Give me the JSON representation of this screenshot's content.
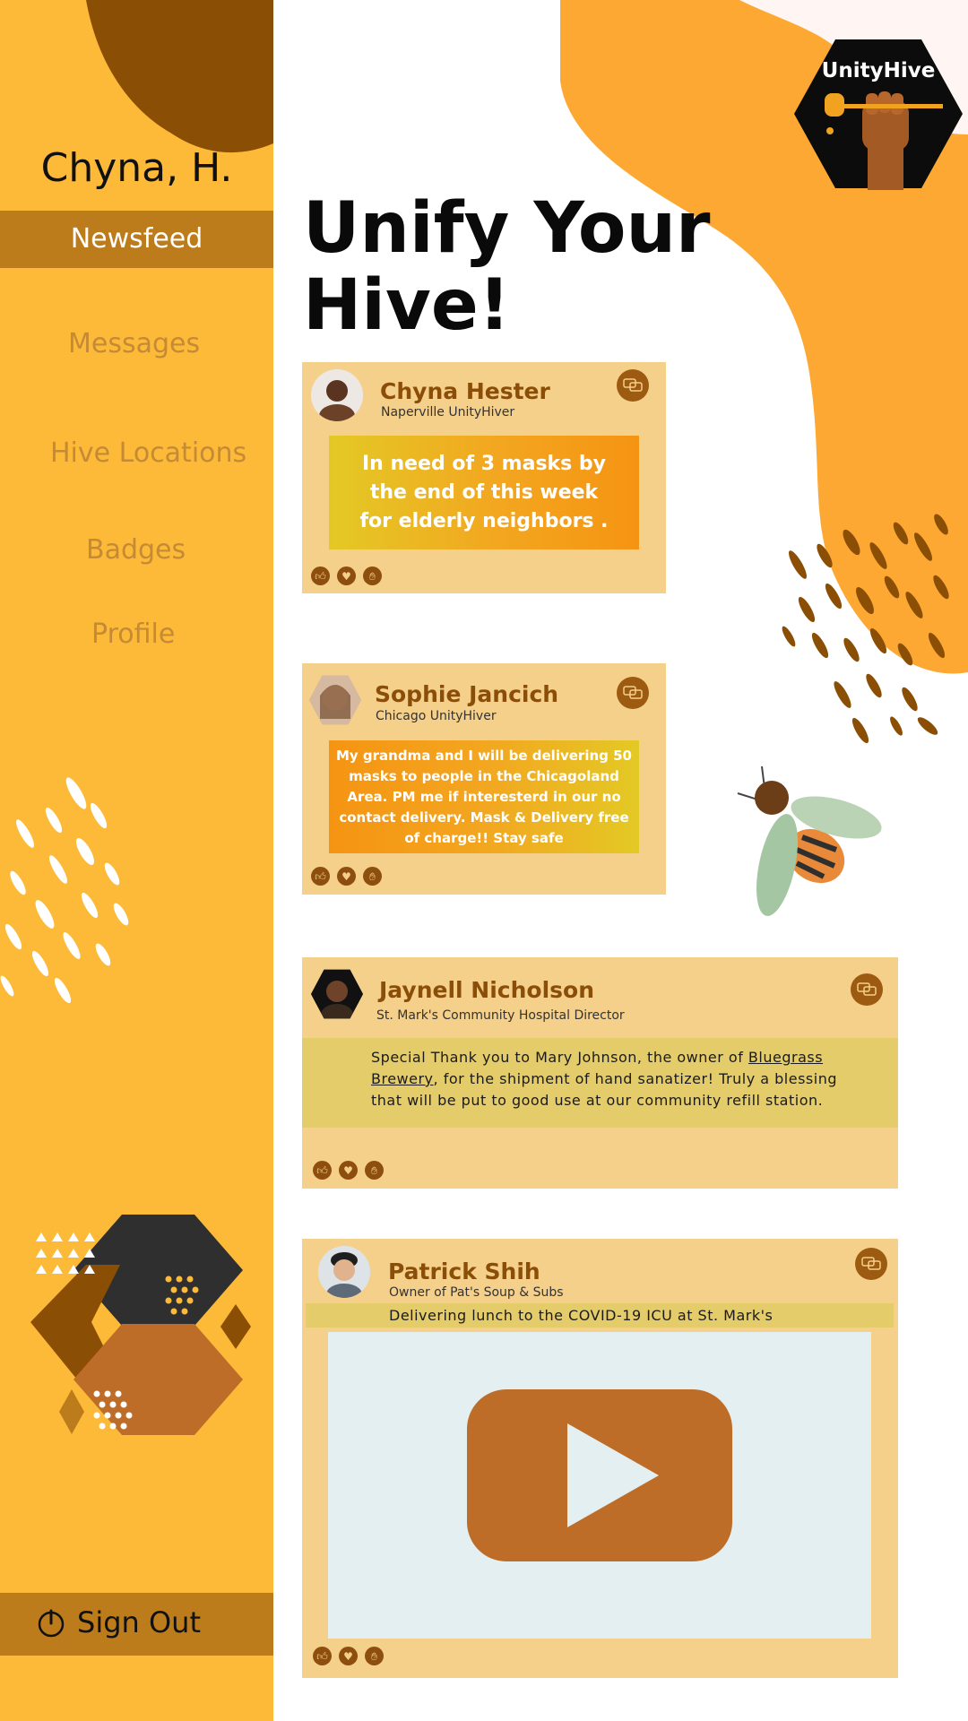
{
  "app": {
    "logo_text": "UnityHive",
    "headline": "Unify Your Hive!"
  },
  "sidebar": {
    "user_name": "Chyna, H.",
    "items": [
      {
        "label": "Newsfeed",
        "active": true
      },
      {
        "label": "Messages"
      },
      {
        "label": "Hive Locations"
      },
      {
        "label": "Badges"
      },
      {
        "label": "Profile"
      }
    ],
    "sign_out": "Sign Out"
  },
  "posts": [
    {
      "author": "Chyna Hester",
      "subtitle": "Naperville UnityHiver",
      "message": "In need of 3 masks by the end of this week for elderly neighbors ."
    },
    {
      "author": "Sophie Jancich",
      "subtitle": "Chicago UnityHiver",
      "message": "My grandma and I will be delivering 50 masks to people in the Chicagoland Area. PM me if interesterd in our no contact delivery. Mask & Delivery free  of charge!! Stay safe"
    },
    {
      "author": "Jaynell Nicholson",
      "subtitle": "St. Mark's Community Hospital Director",
      "message_before": "Special Thank you to Mary Johnson, the owner of ",
      "message_link": "Bluegrass Brewery",
      "message_after": ", for the shipment of hand sanatizer! Truly a blessing that will be put to good use at our community refill station."
    },
    {
      "author": "Patrick Shih",
      "subtitle": "Owner of Pat's Soup & Subs",
      "message": "Delivering lunch to the COVID-19 ICU at St. Mark's"
    }
  ],
  "icons": {
    "menu": "hamburger-menu-icon",
    "comment": "comment-bubbles-icon",
    "like": "thumbs-up-icon",
    "love": "heart-icon",
    "clap": "clap-icon",
    "power": "power-icon",
    "play": "play-icon"
  },
  "colors": {
    "sidebar": "#fdba38",
    "sidebar_active": "#bd7c1b",
    "post_card": "#f5d08b",
    "author": "#8b4e08",
    "accent_orange": "#fca833",
    "dark_brown": "#8b4e05"
  }
}
